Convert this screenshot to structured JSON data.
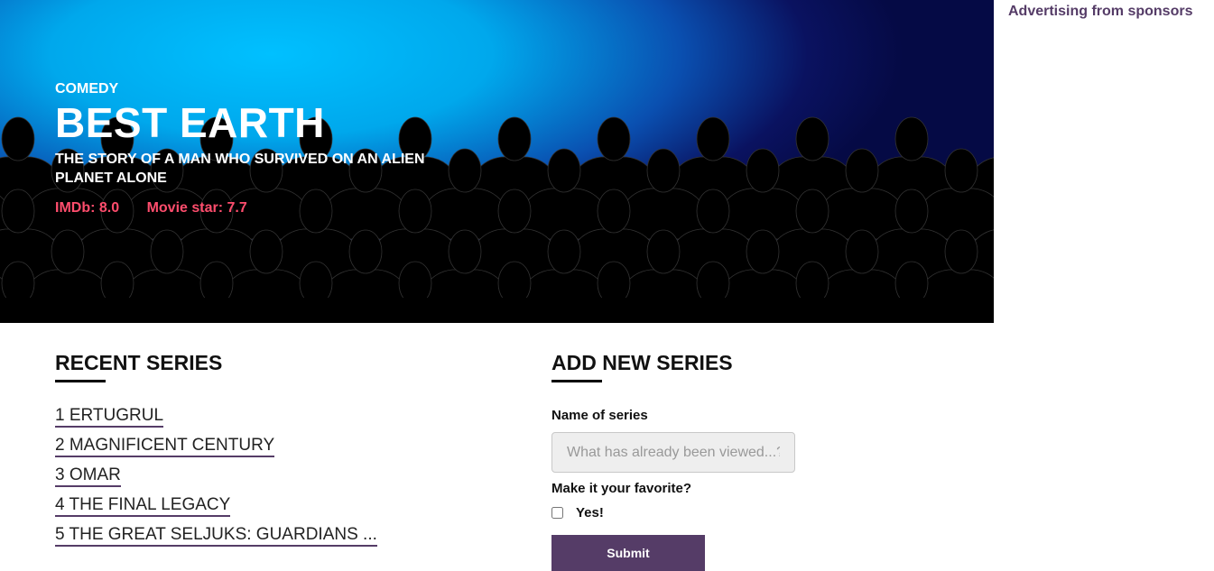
{
  "hero": {
    "genre": "COMEDY",
    "title": "BEST EARTH",
    "tagline": "THE STORY OF A MAN WHO SURVIVED ON AN ALIEN PLANET ALONE",
    "imdb": "IMDb: 8.0",
    "movie_star": "Movie star: 7.7",
    "rating_color": "#ff4d6d"
  },
  "sidebar": {
    "ads_label": "Advertising from sponsors"
  },
  "recent": {
    "heading": "RECENT SERIES",
    "items": [
      "1 ERTUGRUL",
      "2 MAGNIFICENT CENTURY",
      "3 OMAR",
      "4 THE FINAL LEGACY",
      "5 THE GREAT SELJUKS: GUARDIANS ..."
    ]
  },
  "form": {
    "heading": "ADD NEW SERIES",
    "name_label": "Name of series",
    "name_placeholder": "What has already been viewed...?",
    "name_value": "",
    "favorite_label": "Make it your favorite?",
    "yes_label": "Yes!",
    "yes_checked": false,
    "submit_label": "Submit"
  },
  "colors": {
    "accent": "#553c67"
  }
}
